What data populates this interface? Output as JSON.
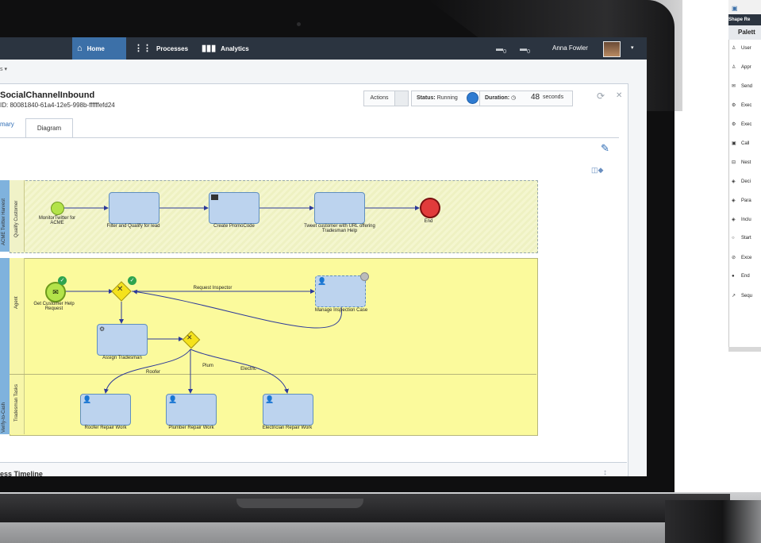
{
  "app": {
    "nav": {
      "home": "Home",
      "processes": "Processes",
      "analytics": "Analytics"
    },
    "notifications": [
      {
        "count": "0"
      },
      {
        "count": "0"
      }
    ],
    "user": {
      "name": "Anna Fowler"
    },
    "subbar_text": "s ▾"
  },
  "instance": {
    "title": "SocialChannelInbound",
    "id_text": "ID: 80081840-61a4-12e5-998b-ffffffefd24",
    "actions_label": "Actions",
    "status_label": "Status:",
    "status_value": "Running",
    "duration_label": "Duration:",
    "duration_value": "48",
    "duration_unit": "seconds"
  },
  "tabs": {
    "summary": "mary",
    "diagram": "Diagram"
  },
  "diagram": {
    "lanes": {
      "top_pool": "ACME Twitter Harvest",
      "top_lane": "Qualify Customer",
      "agent_lane": "Agent",
      "bottom_pool": "Verify-to-Cash",
      "tradesman_lane": "Tradesman Tasks"
    },
    "nodes": {
      "start_twitter": "MonitorTwitter for ACME",
      "filter": "Filter and Qualify for lead",
      "promo": "Create PromoCode",
      "tweet": "Tweet customer with URL offering Tradesman Help",
      "end": "End",
      "get_help": "Get Customer Help Request",
      "manage": "Manage Inspection Case",
      "assign": "Assign Tradesman",
      "roofer": "Roofer Repair Work",
      "plumber": "Plumber Repair Work",
      "electrician": "Electrician Repair Work"
    },
    "flows": {
      "request_inspector": "Request Inspector",
      "roofer": "Roofer",
      "plum": "Plum",
      "electric": "Electric"
    }
  },
  "timeline": {
    "label": "ess Timeline"
  },
  "side_window": {
    "header": "Shape Re",
    "palette_title": "Palett",
    "items": [
      {
        "label": "User",
        "icon": "user-icon"
      },
      {
        "label": "Appr",
        "icon": "approval-icon"
      },
      {
        "label": "Send",
        "icon": "mail-icon"
      },
      {
        "label": "Exec",
        "icon": "gear-icon"
      },
      {
        "label": "Exec",
        "icon": "gear-icon"
      },
      {
        "label": "Call",
        "icon": "call-activity-icon"
      },
      {
        "label": "Nest",
        "icon": "nested-icon"
      },
      {
        "label": "Deci",
        "icon": "decision-gateway-icon"
      },
      {
        "label": "Para",
        "icon": "parallel-gateway-icon"
      },
      {
        "label": "Inclu",
        "icon": "inclusive-gateway-icon"
      },
      {
        "label": "Start",
        "icon": "start-event-icon"
      },
      {
        "label": "Exce",
        "icon": "exception-icon"
      },
      {
        "label": "End",
        "icon": "end-event-icon"
      },
      {
        "label": "Sequ",
        "icon": "sequence-flow-icon"
      }
    ]
  },
  "colors": {
    "topbar": "#2b3440",
    "accent": "#3c70a8",
    "lane_yellow": "#fbfa9c",
    "task_blue": "#bcd3ee",
    "start_green": "#b3e34a",
    "end_red": "#e13b3b",
    "gateway_yellow": "#f5e21c"
  }
}
